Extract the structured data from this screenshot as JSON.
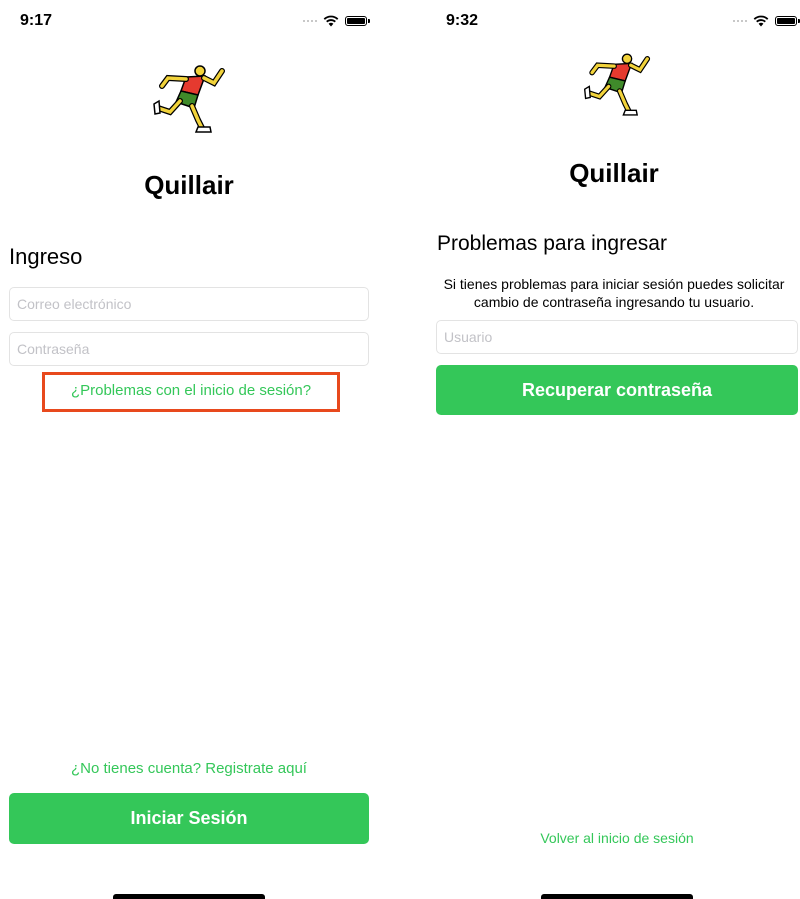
{
  "colors": {
    "accent": "#34c759",
    "highlight_border": "#e8491d",
    "input_border": "#e3e3e3",
    "placeholder": "#c2c2c7"
  },
  "icons": {
    "logo": "runner-icon",
    "wifi": "wifi-icon",
    "battery": "battery-icon",
    "signal": "signal-icon"
  },
  "login_screen": {
    "status_time": "9:17",
    "app_title": "Quillair",
    "heading": "Ingreso",
    "email_placeholder": "Correo electrónico",
    "password_placeholder": "Contraseña",
    "trouble_link": "¿Problemas con el inicio de sesión?",
    "register_link": "¿No tienes cuenta? Registrate aquí",
    "login_button": "Iniciar Sesión"
  },
  "recovery_screen": {
    "status_time": "9:32",
    "app_title": "Quillair",
    "heading": "Problemas para ingresar",
    "description": "Si tienes problemas para iniciar sesión puedes solicitar cambio de contraseña ingresando tu usuario.",
    "username_placeholder": "Usuario",
    "recover_button": "Recuperar contraseña",
    "back_link": "Volver al inicio de sesión"
  }
}
